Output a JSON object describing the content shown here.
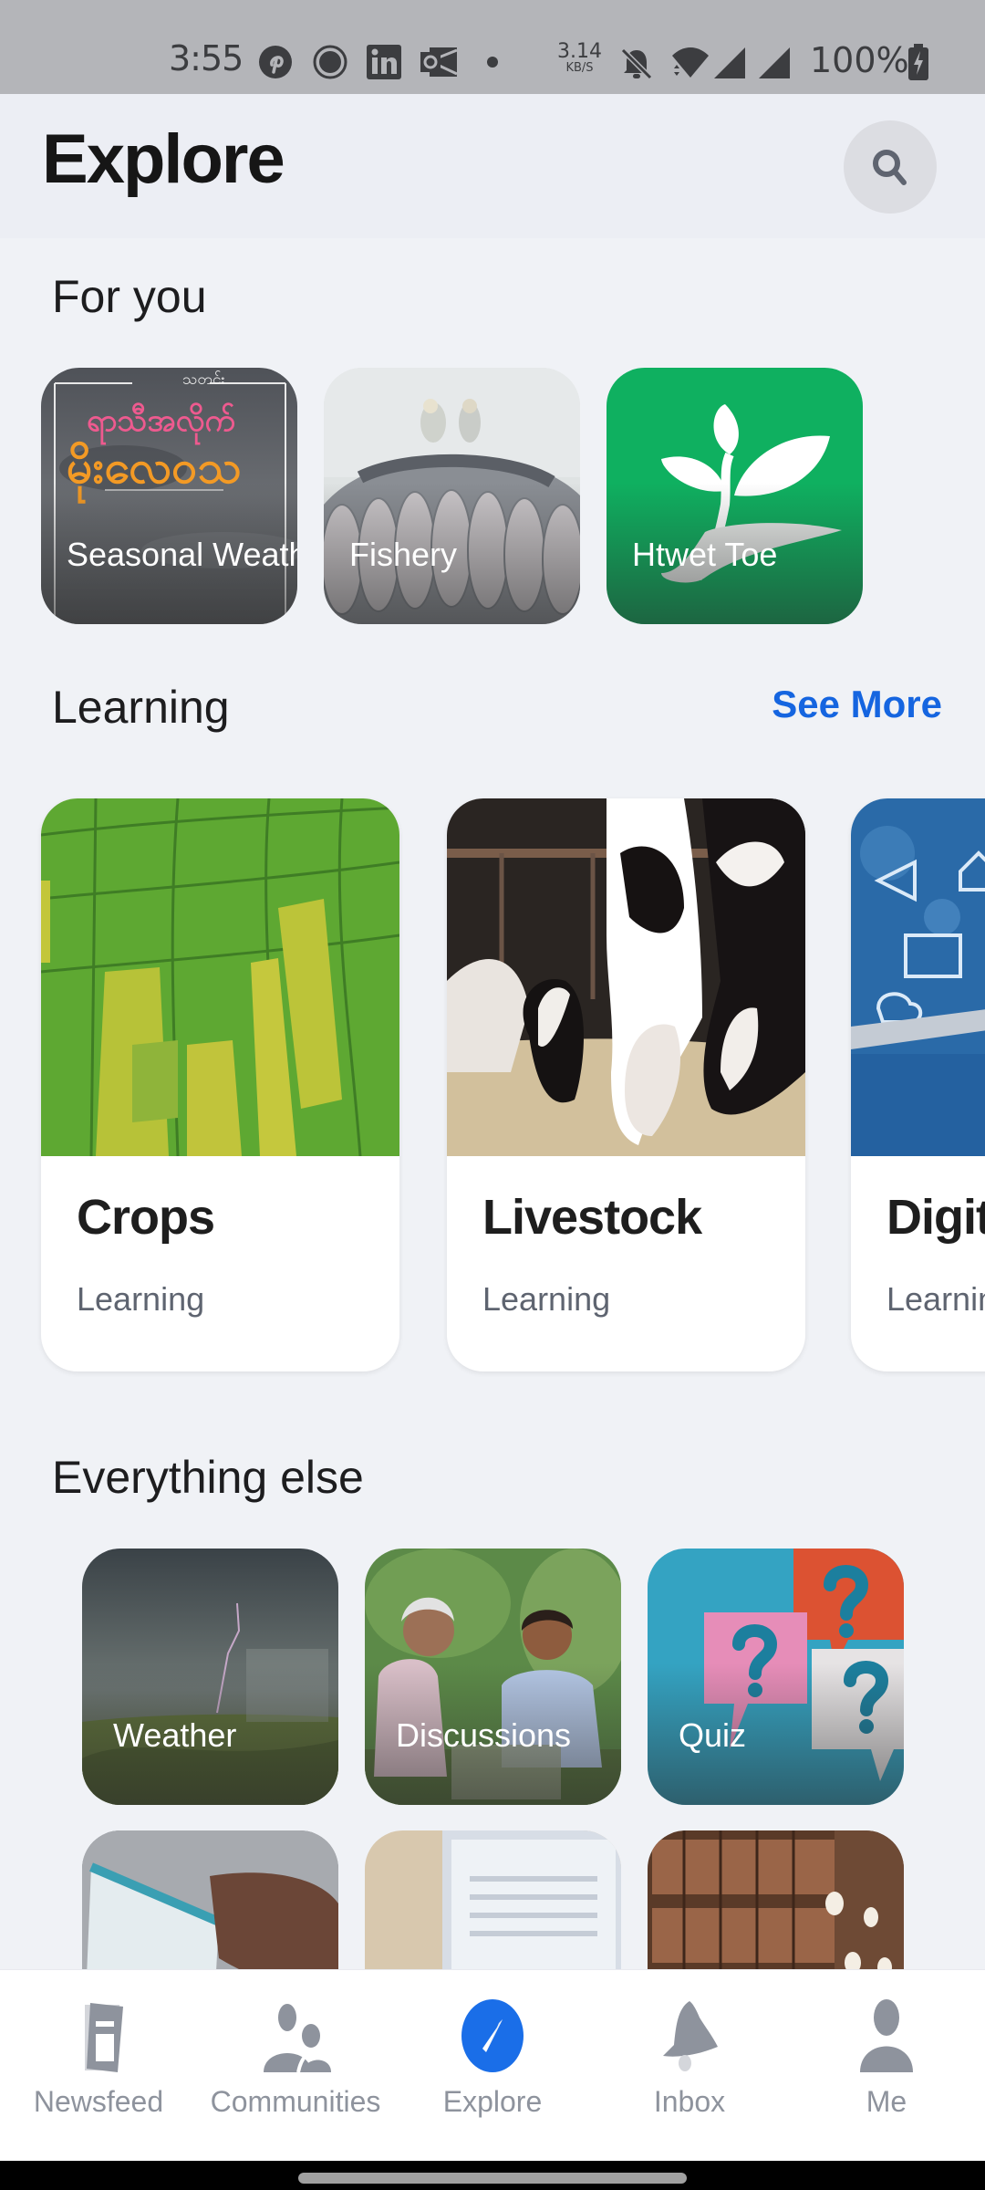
{
  "status_bar": {
    "time": "3:55",
    "notification_icons": [
      "pinterest-icon",
      "record-icon",
      "linkedin-icon",
      "outlook-icon",
      "dot-icon"
    ],
    "net_speed_value": "3.14",
    "net_speed_unit": "KB/S",
    "system_icons": [
      "bell-muted-icon",
      "wifi-icon",
      "signal-icon",
      "signal-icon"
    ],
    "battery": "100%"
  },
  "header": {
    "title": "Explore",
    "search_icon": "search-icon"
  },
  "for_you": {
    "title": "For you",
    "items": [
      {
        "label": "Seasonal Weath",
        "overlay_small": "သတင်း",
        "overlay_pink": "ရာသီအလိုက်",
        "overlay_orange": "မိုးလေဝသ"
      },
      {
        "label": "Fishery"
      },
      {
        "label": "Htwet Toe"
      }
    ]
  },
  "learning": {
    "title": "Learning",
    "see_more": "See More",
    "cards": [
      {
        "name": "Crops",
        "subtitle": "Learning"
      },
      {
        "name": "Livestock",
        "subtitle": "Learning"
      },
      {
        "name": "Digit",
        "subtitle": "Learnin"
      }
    ]
  },
  "everything_else": {
    "title": "Everything else",
    "items": [
      {
        "label": "Weather"
      },
      {
        "label": "Discussions"
      },
      {
        "label": "Quiz"
      },
      {
        "label": ""
      },
      {
        "label": ""
      },
      {
        "label": ""
      }
    ]
  },
  "bottom_nav": {
    "active": "Explore",
    "active_color": "#1a6ee8",
    "inactive_color": "#8e939d",
    "items": [
      {
        "label": "Newsfeed",
        "icon": "newsfeed-icon"
      },
      {
        "label": "Communities",
        "icon": "communities-icon"
      },
      {
        "label": "Explore",
        "icon": "compass-icon"
      },
      {
        "label": "Inbox",
        "icon": "bell-icon"
      },
      {
        "label": "Me",
        "icon": "person-icon"
      }
    ]
  },
  "colors": {
    "accent": "#1565e0",
    "htwet_toe_green": "#0fb060",
    "background": "#f0f2f6"
  }
}
